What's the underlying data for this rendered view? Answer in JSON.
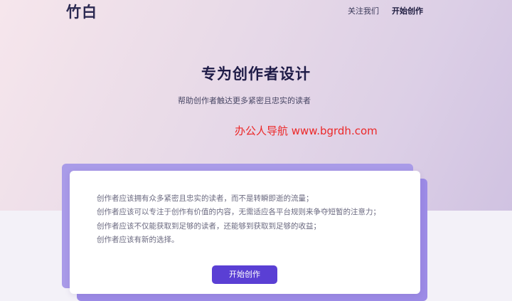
{
  "header": {
    "logo": "竹白",
    "nav": {
      "follow_us": "关注我们",
      "start_creating": "开始创作"
    }
  },
  "hero": {
    "title": "专为创作者设计",
    "subtitle": "帮助创作者触达更多紧密且忠实的读者"
  },
  "watermark": "办公人导航 www.bgrdh.com",
  "card": {
    "lines": [
      "创作者应该拥有众多紧密且忠实的读者，而不是转瞬即逝的流量；",
      "创作者应该可以专注于创作有价值的内容，无需适应各平台规则来争夺短暂的注意力；",
      "创作者应该不仅能获取到足够的读者，还能够到获取到足够的收益；",
      "创作者应该有新的选择。"
    ],
    "button_label": "开始创作"
  },
  "colors": {
    "accent": "#5a3fd4",
    "title": "#1e1b47",
    "watermark": "#ec2828",
    "deco": "#a99be8"
  }
}
